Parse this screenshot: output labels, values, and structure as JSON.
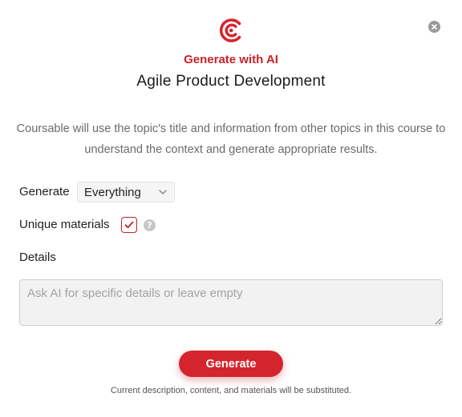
{
  "modal": {
    "logo_icon": "coursable-logo-icon",
    "close_icon": "close-icon",
    "subtitle": "Generate with AI",
    "title": "Agile Product Development",
    "description": "Coursable will use the topic's title and information from other topics in this course to understand the context and generate appropriate results.",
    "accent_color": "#d4252c"
  },
  "form": {
    "generate_label": "Generate",
    "generate_select_value": "Everything",
    "unique_materials_label": "Unique materials",
    "unique_materials_checked": true,
    "help_icon_glyph": "?",
    "details_label": "Details",
    "details_placeholder": "Ask AI for specific details or leave empty",
    "details_value": ""
  },
  "actions": {
    "generate_button_label": "Generate",
    "footnote": "Current description, content, and materials will be substituted."
  }
}
